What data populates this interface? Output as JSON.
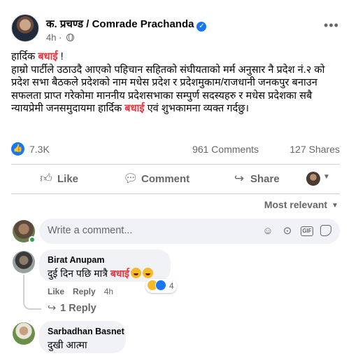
{
  "post": {
    "author": "क. प्रचण्ड / Comrade Prachanda",
    "verified_icon": "verified-badge-icon",
    "time": "4h",
    "privacy_icon": "globe-icon",
    "more_label": "•••",
    "body": {
      "line1_prefix": "हार्दिक ",
      "highlight": "बधाई",
      "line1_suffix": " !",
      "para_part1": "हाम्रो पार्टीले उठाउदै आएको पहिचान सहितको संघीयताको मर्म अनुसार नै प्रदेश नं.२ को प्रदेश सभा बैठकले प्रदेशको नाम मधेस प्रदेश र प्रदेशमुकाम/राजधानी जनकपुर बनाउन सफलता प्राप्त गरेकोमा माननीय प्रदेशसभाका सम्पुर्ण सदस्यहरु र मधेस प्रदेशका सबै न्यायप्रेमी जनसमुदायमा हार्दिक ",
      "para_highlight": "बधाई",
      "para_part2": " एवं शुभकामना व्यक्त गर्दछु।"
    },
    "stats": {
      "likes": "7.3K",
      "comments": "961 Comments",
      "shares": "127 Shares"
    },
    "actions": {
      "like": "Like",
      "comment": "Comment",
      "share": "Share"
    },
    "filter": "Most relevant",
    "write_placeholder": "Write a comment..."
  },
  "colors": {
    "accent": "#1877f2",
    "highlight": "#e4383f",
    "secondary_text": "#65676b",
    "bubble": "#f0f2f5"
  },
  "comments": [
    {
      "author": "Birat Anupam",
      "text_prefix": "दुई दिन पछि मात्रै ",
      "text_highlight": "बधाई",
      "like_label": "Like",
      "reply_label": "Reply",
      "time": "4h",
      "reaction_count": "4",
      "replies_label": "1 Reply"
    },
    {
      "author": "Sarbadhan Basnet",
      "text": "दुखी आत्मा"
    }
  ]
}
